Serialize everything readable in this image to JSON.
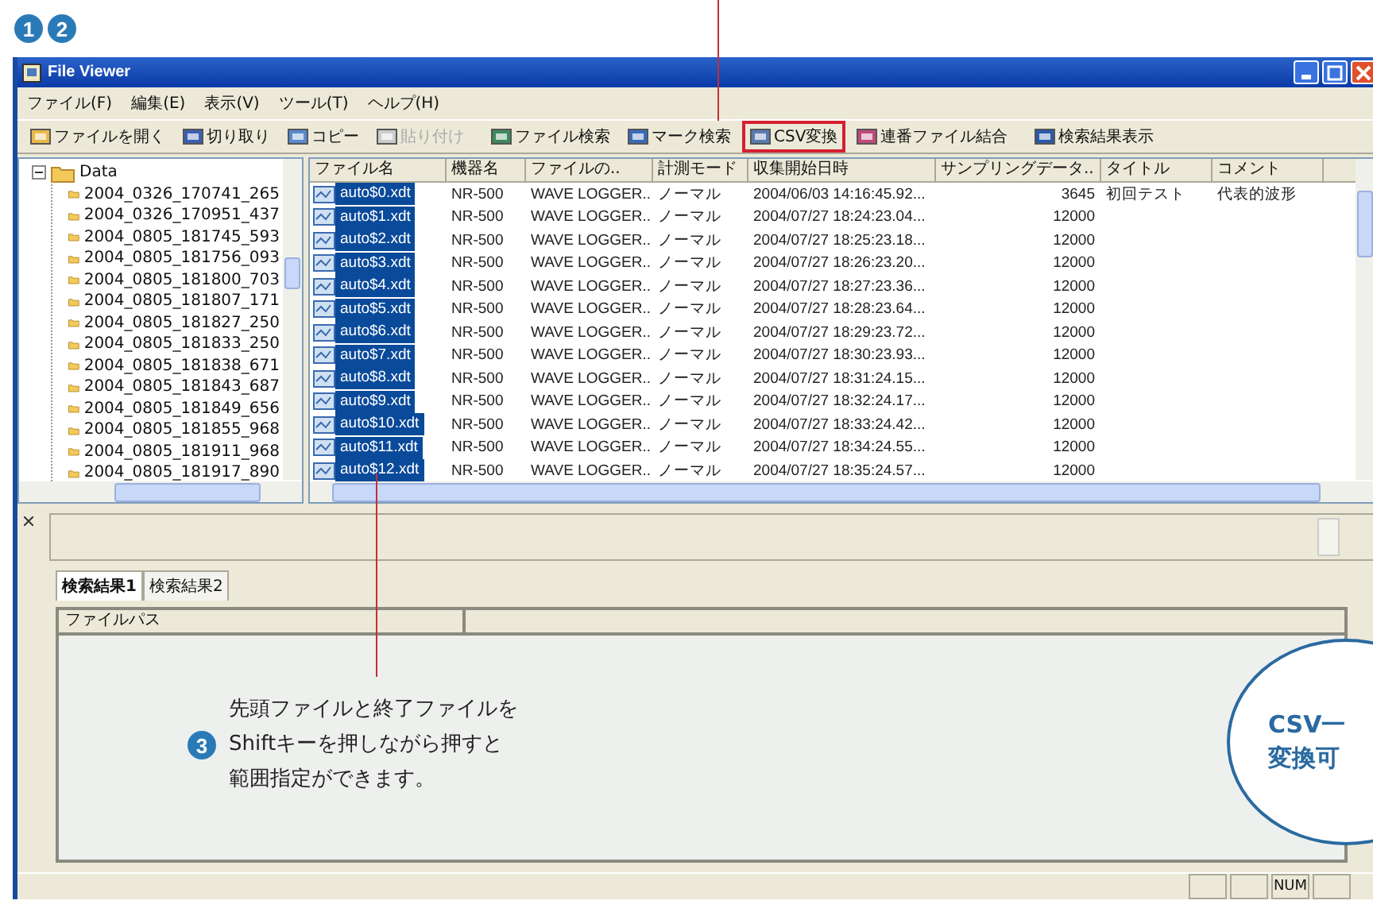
{
  "step_badges": [
    "1",
    "2"
  ],
  "window": {
    "title": "File Viewer"
  },
  "menu": [
    "ファイル(F)",
    "編集(E)",
    "表示(V)",
    "ツール(T)",
    "ヘルプ(H)"
  ],
  "toolbar": [
    {
      "label": "ファイルを開く",
      "disabled": false,
      "highlighted": false
    },
    {
      "label": "切り取り",
      "disabled": false,
      "highlighted": false
    },
    {
      "label": "コピー",
      "disabled": false,
      "highlighted": false
    },
    {
      "label": "貼り付け",
      "disabled": true,
      "highlighted": false
    },
    {
      "label": "ファイル検索",
      "disabled": false,
      "highlighted": false
    },
    {
      "label": "マーク検索",
      "disabled": false,
      "highlighted": false
    },
    {
      "label": "CSV変換",
      "disabled": false,
      "highlighted": true
    },
    {
      "label": "連番ファイル結合",
      "disabled": false,
      "highlighted": false
    },
    {
      "label": "検索結果表示",
      "disabled": false,
      "highlighted": false
    }
  ],
  "tree": {
    "label": "Data",
    "expanded": true,
    "children": [
      {
        "label": "2004_0326_170741_265"
      },
      {
        "label": "2004_0326_170951_437"
      },
      {
        "label": "2004_0805_181745_593"
      },
      {
        "label": "2004_0805_181756_093"
      },
      {
        "label": "2004_0805_181800_703"
      },
      {
        "label": "2004_0805_181807_171"
      },
      {
        "label": "2004_0805_181827_250"
      },
      {
        "label": "2004_0805_181833_250"
      },
      {
        "label": "2004_0805_181838_671"
      },
      {
        "label": "2004_0805_181843_687"
      },
      {
        "label": "2004_0805_181849_656"
      },
      {
        "label": "2004_0805_181855_968"
      },
      {
        "label": "2004_0805_181911_968"
      },
      {
        "label": "2004_0805_181917_890"
      }
    ]
  },
  "file_list": {
    "columns": [
      "ファイル名",
      "機器名",
      "ファイルの..",
      "計測モード",
      "収集開始日時",
      "サンプリングデータ..",
      "タイトル",
      "コメント"
    ],
    "rows": [
      {
        "selected": true,
        "cells": [
          "auto$0.xdt",
          "NR-500",
          "WAVE LOGGER..",
          "ノーマル",
          "2004/06/03 14:16:45.92...",
          "3645",
          "初回テスト",
          "代表的波形"
        ]
      },
      {
        "selected": true,
        "cells": [
          "auto$1.xdt",
          "NR-500",
          "WAVE LOGGER..",
          "ノーマル",
          "2004/07/27 18:24:23.04...",
          "12000"
        ]
      },
      {
        "selected": true,
        "cells": [
          "auto$2.xdt",
          "NR-500",
          "WAVE LOGGER..",
          "ノーマル",
          "2004/07/27 18:25:23.18...",
          "12000"
        ]
      },
      {
        "selected": true,
        "cells": [
          "auto$3.xdt",
          "NR-500",
          "WAVE LOGGER..",
          "ノーマル",
          "2004/07/27 18:26:23.20...",
          "12000"
        ]
      },
      {
        "selected": true,
        "cells": [
          "auto$4.xdt",
          "NR-500",
          "WAVE LOGGER..",
          "ノーマル",
          "2004/07/27 18:27:23.36...",
          "12000"
        ]
      },
      {
        "selected": true,
        "cells": [
          "auto$5.xdt",
          "NR-500",
          "WAVE LOGGER..",
          "ノーマル",
          "2004/07/27 18:28:23.64...",
          "12000"
        ]
      },
      {
        "selected": true,
        "cells": [
          "auto$6.xdt",
          "NR-500",
          "WAVE LOGGER..",
          "ノーマル",
          "2004/07/27 18:29:23.72...",
          "12000"
        ]
      },
      {
        "selected": true,
        "cells": [
          "auto$7.xdt",
          "NR-500",
          "WAVE LOGGER..",
          "ノーマル",
          "2004/07/27 18:30:23.93...",
          "12000"
        ]
      },
      {
        "selected": true,
        "cells": [
          "auto$8.xdt",
          "NR-500",
          "WAVE LOGGER..",
          "ノーマル",
          "2004/07/27 18:31:24.15...",
          "12000"
        ]
      },
      {
        "selected": true,
        "cells": [
          "auto$9.xdt",
          "NR-500",
          "WAVE LOGGER..",
          "ノーマル",
          "2004/07/27 18:32:24.17...",
          "12000"
        ]
      },
      {
        "selected": true,
        "cells": [
          "auto$10.xdt",
          "NR-500",
          "WAVE LOGGER..",
          "ノーマル",
          "2004/07/27 18:33:24.42...",
          "12000"
        ]
      },
      {
        "selected": true,
        "cells": [
          "auto$11.xdt",
          "NR-500",
          "WAVE LOGGER..",
          "ノーマル",
          "2004/07/27 18:34:24.55...",
          "12000"
        ]
      },
      {
        "selected": true,
        "cells": [
          "auto$12.xdt",
          "NR-500",
          "WAVE LOGGER..",
          "ノーマル",
          "2004/07/27 18:35:24.57...",
          "12000"
        ]
      }
    ]
  },
  "result_tabs": [
    {
      "label": "検索結果1",
      "selected": true
    },
    {
      "label": "検索結果2",
      "selected": false
    }
  ],
  "result_table": {
    "columns": [
      "ファイルパス"
    ]
  },
  "status_bar": {
    "indicator": "NUM"
  },
  "callout": {
    "badge": "3",
    "lines": [
      "先頭ファイルと終了ファイルを",
      "Shiftキーを押しながら押すと",
      "範囲指定ができます。"
    ]
  },
  "bubble": {
    "lines": [
      "CSV一",
      "変換可"
    ]
  }
}
